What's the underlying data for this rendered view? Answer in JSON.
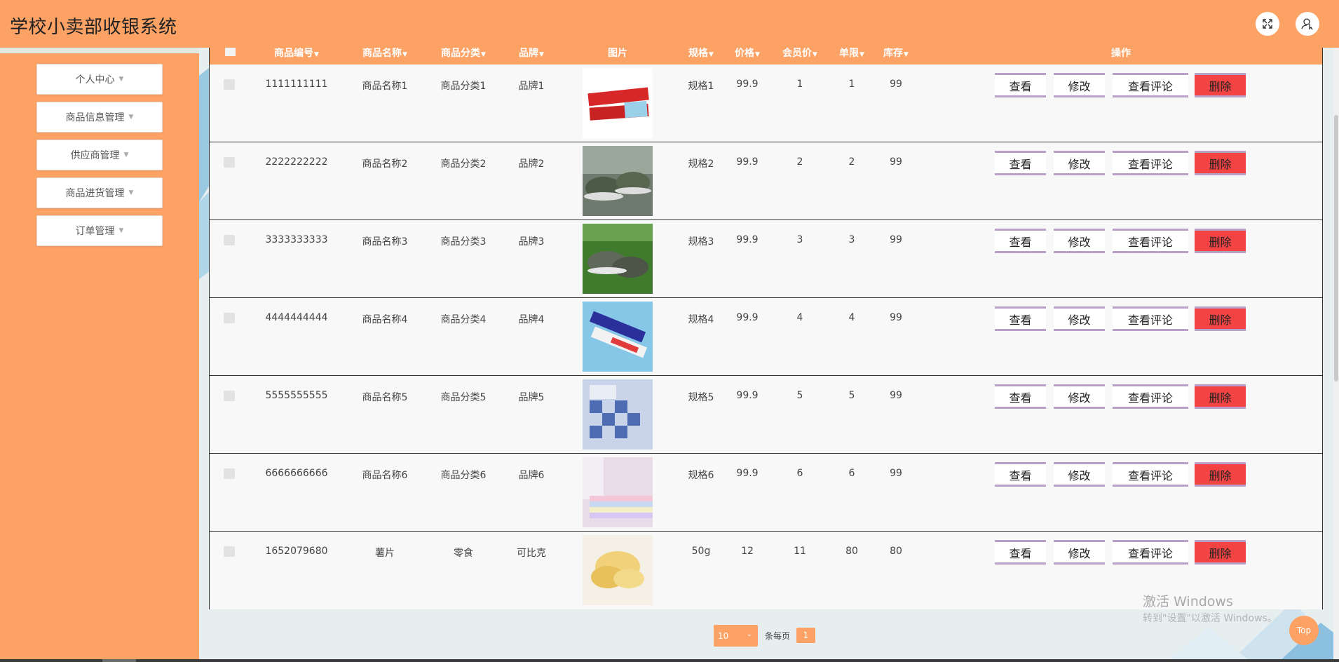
{
  "header": {
    "title": "学校小卖部收银系统",
    "fullscreen_icon": "expand-icon",
    "user_icon": "user-icon"
  },
  "sidebar": {
    "items": [
      {
        "label": "个人中心"
      },
      {
        "label": "商品信息管理"
      },
      {
        "label": "供应商管理"
      },
      {
        "label": "商品进货管理"
      },
      {
        "label": "订单管理"
      }
    ]
  },
  "table": {
    "columns": [
      "商品编号",
      "商品名称",
      "商品分类",
      "品牌",
      "图片",
      "规格",
      "价格",
      "会员价",
      "单限",
      "库存",
      "操作"
    ],
    "rows": [
      {
        "id": "1111111111",
        "name": "商品名称1",
        "category": "商品分类1",
        "brand": "品牌1",
        "image": "toothpaste",
        "spec": "规格1",
        "price": "99.9",
        "member_price": "1",
        "limit": "1",
        "stock": "99"
      },
      {
        "id": "2222222222",
        "name": "商品名称2",
        "category": "商品分类2",
        "brand": "品牌2",
        "image": "camo-shoes",
        "spec": "规格2",
        "price": "99.9",
        "member_price": "2",
        "limit": "2",
        "stock": "99"
      },
      {
        "id": "3333333333",
        "name": "商品名称3",
        "category": "商品分类3",
        "brand": "品牌3",
        "image": "camo-shoes-grass",
        "spec": "规格3",
        "price": "99.9",
        "member_price": "3",
        "limit": "3",
        "stock": "99"
      },
      {
        "id": "4444444444",
        "name": "商品名称4",
        "category": "商品分类4",
        "brand": "品牌4",
        "image": "toothpaste-blue",
        "spec": "规格4",
        "price": "99.9",
        "member_price": "4",
        "limit": "4",
        "stock": "99"
      },
      {
        "id": "5555555555",
        "name": "商品名称5",
        "category": "商品分类5",
        "brand": "品牌5",
        "image": "bedding-blue",
        "spec": "规格5",
        "price": "99.9",
        "member_price": "5",
        "limit": "5",
        "stock": "99"
      },
      {
        "id": "6666666666",
        "name": "商品名称6",
        "category": "商品分类6",
        "brand": "品牌6",
        "image": "bedding-pastel",
        "spec": "规格6",
        "price": "99.9",
        "member_price": "6",
        "limit": "6",
        "stock": "99"
      },
      {
        "id": "1652079680",
        "name": "薯片",
        "category": "零食",
        "brand": "可比克",
        "image": "potato-chips",
        "spec": "50g",
        "price": "12",
        "member_price": "11",
        "limit": "80",
        "stock": "80"
      }
    ],
    "actions": {
      "view": "查看",
      "edit": "修改",
      "reviews": "查看评论",
      "delete": "删除"
    }
  },
  "pagination": {
    "page_size": "10",
    "per_page_label": "条每页",
    "current_page": "1"
  },
  "watermark": {
    "line1": "激活 Windows",
    "line2": "转到\"设置\"以激活 Windows。"
  },
  "top_button": "Top",
  "colors": {
    "accent": "#fca265",
    "delete": "#f44343",
    "button_border": "#b9a0c9"
  }
}
